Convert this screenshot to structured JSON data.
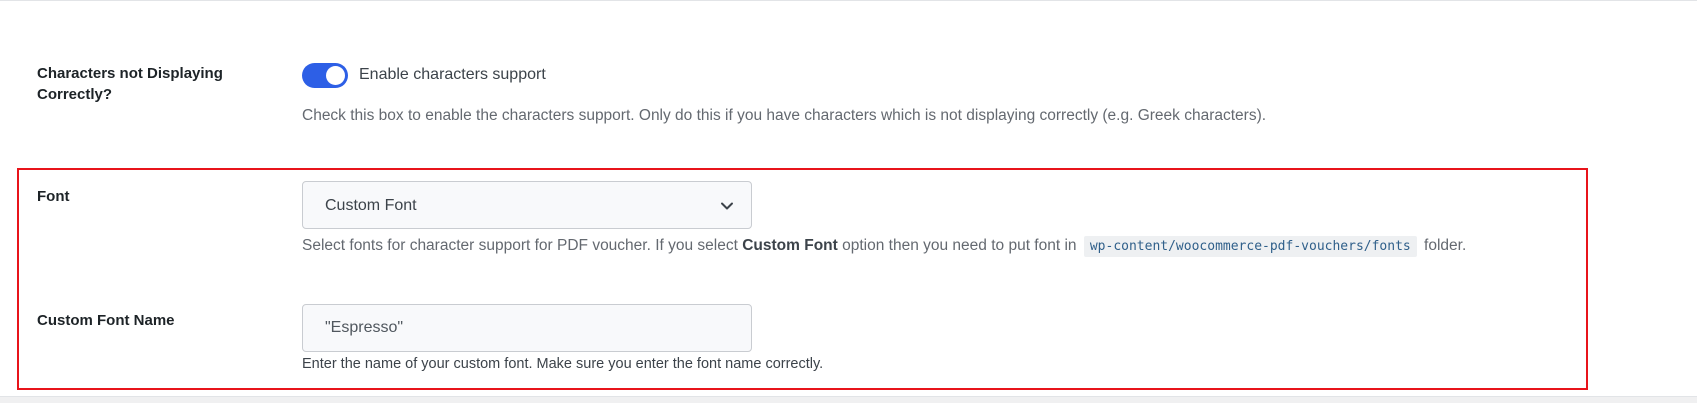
{
  "settings": {
    "characters": {
      "label": "Characters not Displaying Correctly?",
      "toggle_on": true,
      "toggle_label": "Enable characters support",
      "description": "Check this box to enable the characters support. Only do this if you have characters which is not displaying correctly (e.g. Greek characters)."
    },
    "font": {
      "label": "Font",
      "selected_value": "Custom Font",
      "description_prefix": "Select fonts for character support for PDF voucher. If you select ",
      "description_bold": "Custom Font",
      "description_middle": " option then you need to put font in ",
      "description_code": "wp-content/woocommerce-pdf-vouchers/fonts",
      "description_suffix": " folder."
    },
    "custom_font_name": {
      "label": "Custom Font Name",
      "value": "\"Espresso\"",
      "description": "Enter the name of your custom font. Make sure you enter the font name correctly."
    }
  },
  "colors": {
    "toggle_active": "#2d5fe6",
    "highlight_border": "#e8141b"
  },
  "icons": {
    "select_arrow": "chevron-down-icon"
  }
}
